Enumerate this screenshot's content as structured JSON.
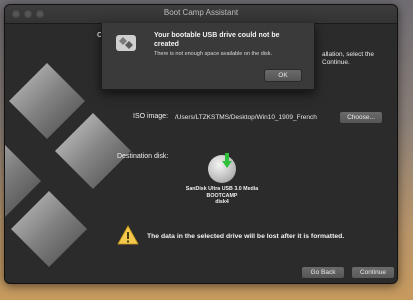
{
  "window": {
    "title": "Boot Camp Assistant"
  },
  "intro": {
    "heading_fragment": "C",
    "text": "allation, select the Continue."
  },
  "iso": {
    "label": "ISO image:",
    "path": "/Users/LTZKSTMS/Desktop/Win10_1909_French",
    "choose_label": "Choose..."
  },
  "destination": {
    "label": "Destination disk:",
    "disk_name": "SanDisk Ultra USB 3.0 Media",
    "disk_volume": "BOOTCAMP",
    "disk_id": "disk4"
  },
  "warning": {
    "text": "The data in the selected drive will be lost after it is formatted."
  },
  "footer": {
    "back_label": "Go Back",
    "continue_label": "Continue"
  },
  "alert": {
    "title": "Your bootable USB drive could not be created",
    "message": "There is not enough space available on the disk.",
    "ok_label": "OK"
  },
  "icons": [
    "bootcamp-logo-icon",
    "usb-drive-icon",
    "warning-icon",
    "bootcamp-app-icon"
  ],
  "colors": {
    "window_bg": "#2b2b2b",
    "sheet_bg": "#3a3a3a",
    "accent_green": "#2fbf3a",
    "warning_yellow": "#f2c94c"
  }
}
